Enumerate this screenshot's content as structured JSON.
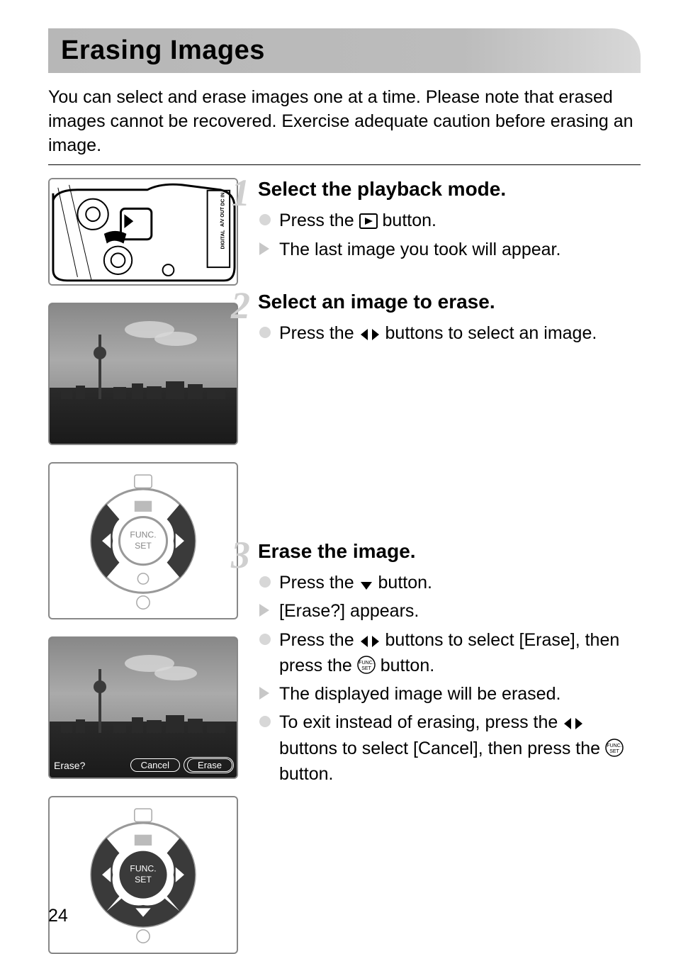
{
  "title": "Erasing Images",
  "intro": "You can select and erase images one at a time. Please note that erased images cannot be recovered. Exercise adequate caution before erasing an image.",
  "page_number": "24",
  "lcd": {
    "prompt": "Erase?",
    "cancel": "Cancel",
    "erase": "Erase"
  },
  "steps": [
    {
      "num": "1",
      "heading": "Select the playback mode.",
      "items": [
        {
          "type": "circle",
          "pre": "Press the ",
          "icon": "playback",
          "post": " button."
        },
        {
          "type": "tri",
          "pre": "The last image you took will appear."
        }
      ]
    },
    {
      "num": "2",
      "heading": "Select an image to erase.",
      "items": [
        {
          "type": "circle",
          "pre": "Press the ",
          "icon": "leftright",
          "post": " buttons to select an image."
        }
      ]
    },
    {
      "num": "3",
      "heading": "Erase the image.",
      "items": [
        {
          "type": "circle",
          "pre": "Press the ",
          "icon": "down",
          "post": " button."
        },
        {
          "type": "tri",
          "pre": "[Erase?] appears."
        },
        {
          "type": "circle",
          "pre": "Press the ",
          "icon": "leftright",
          "post": " buttons to select [Erase], then press the ",
          "icon2": "funcset",
          "post2": " button."
        },
        {
          "type": "tri",
          "pre": "The displayed image will be erased."
        },
        {
          "type": "circle",
          "pre": "To exit instead of erasing, press the ",
          "icon": "leftright",
          "post": " buttons to select [Cancel], then press the ",
          "icon2": "funcset",
          "post2": " button."
        }
      ]
    }
  ]
}
